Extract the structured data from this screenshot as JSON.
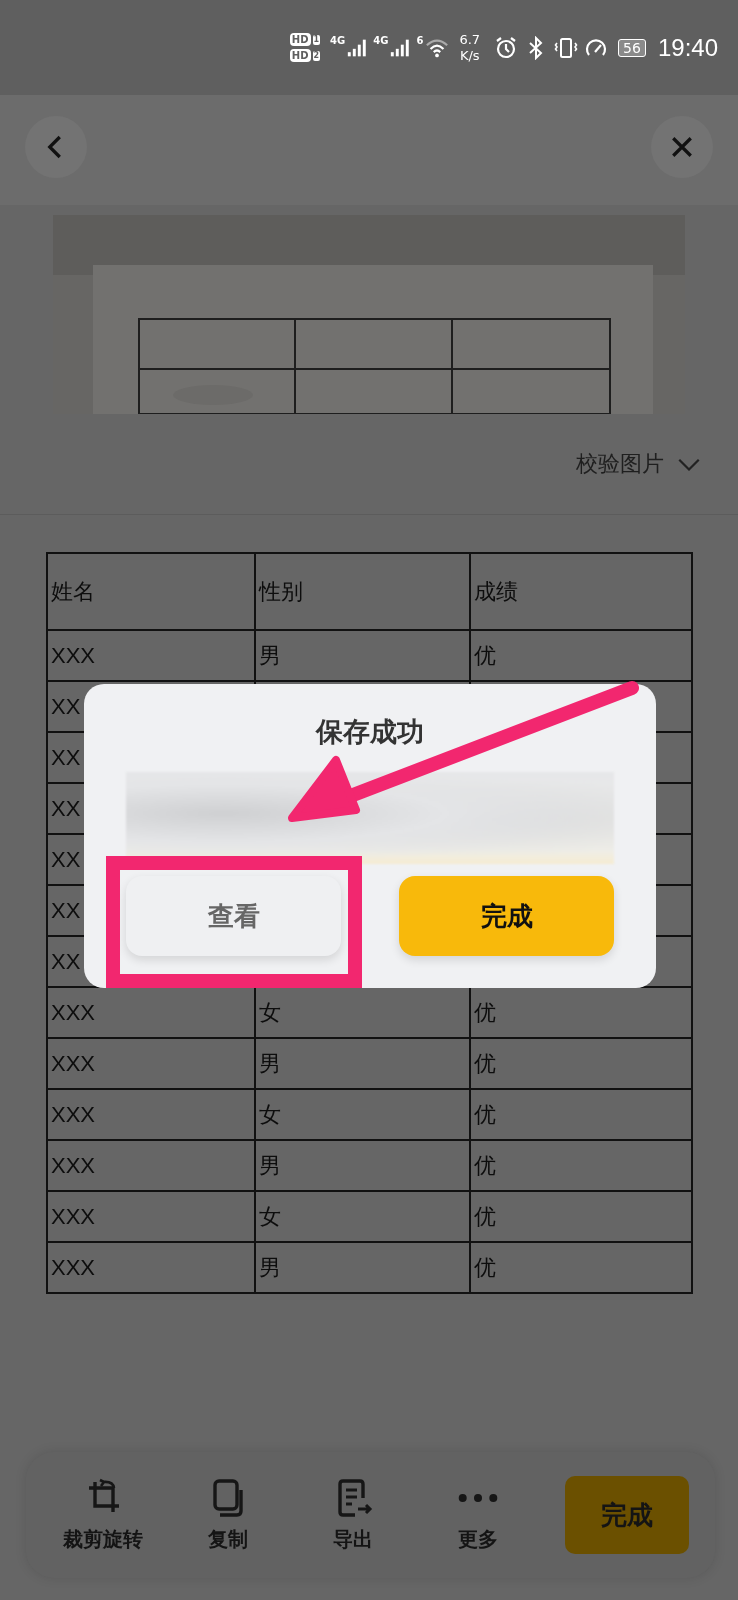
{
  "status_bar": {
    "sims": [
      {
        "badge": "HD",
        "slot": "1",
        "network": "4G"
      },
      {
        "badge": "HD",
        "slot": "2",
        "network": "4G"
      }
    ],
    "wifi_label": "6",
    "speed_value": "6.7",
    "speed_unit": "K/s",
    "battery": "56",
    "time": "19:40"
  },
  "verify_dropdown": {
    "label": "校验图片",
    "expanded": false
  },
  "table": {
    "columns": [
      "姓名",
      "性别",
      "成绩"
    ],
    "rows": [
      [
        "XXX",
        "男",
        "优"
      ],
      [
        "XX"
      ],
      [
        "XX"
      ],
      [
        "XX"
      ],
      [
        "XX"
      ],
      [
        "XX"
      ],
      [
        "XX"
      ],
      [
        "XXX",
        "女",
        "优"
      ],
      [
        "XXX",
        "男",
        "优"
      ],
      [
        "XXX",
        "女",
        "优"
      ],
      [
        "XXX",
        "男",
        "优"
      ],
      [
        "XXX",
        "女",
        "优"
      ],
      [
        "XXX",
        "男",
        "优"
      ]
    ]
  },
  "dialog": {
    "title": "保存成功",
    "buttons": [
      {
        "label": "查看",
        "kind": "secondary"
      },
      {
        "label": "完成",
        "kind": "primary"
      }
    ]
  },
  "toolbar": {
    "items": [
      {
        "label": "裁剪旋转",
        "kind": "crop"
      },
      {
        "label": "复制",
        "kind": "copy"
      },
      {
        "label": "导出",
        "kind": "export"
      },
      {
        "label": "更多",
        "kind": "more"
      }
    ],
    "primary": "完成"
  }
}
